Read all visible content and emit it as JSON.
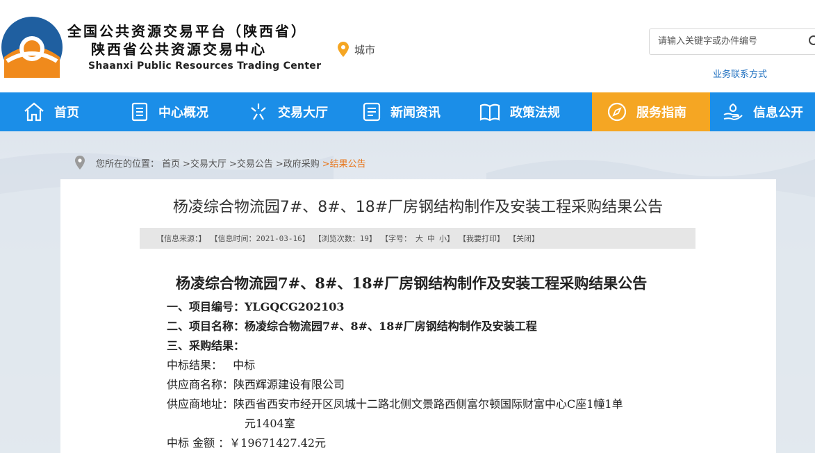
{
  "header": {
    "title_line1": "全国公共资源交易平台（陕西省）",
    "title_line2": "陕西省公共资源交易中心",
    "title_en": "Shaanxi Public Resources Trading Center",
    "city_label": "城市",
    "search_placeholder": "请输入关键字或办件编号",
    "contact_link": "业务联系方式"
  },
  "nav": {
    "items": [
      {
        "label": "首页",
        "icon": "home-icon"
      },
      {
        "label": "中心概况",
        "icon": "document-icon"
      },
      {
        "label": "交易大厅",
        "icon": "sparkle-icon"
      },
      {
        "label": "新闻资讯",
        "icon": "news-icon"
      },
      {
        "label": "政策法规",
        "icon": "book-icon"
      },
      {
        "label": "服务指南",
        "icon": "compass-icon",
        "active": true
      },
      {
        "label": "信息公开",
        "icon": "hand-icon"
      }
    ],
    "active_color": "#f5a623",
    "bar_color": "#1b8ee8"
  },
  "breadcrumb": {
    "prefix": "您所在的位置：",
    "items": [
      "首页",
      ">交易大厅",
      ">交易公告",
      ">政府采购"
    ],
    "current": ">结果公告"
  },
  "article": {
    "page_title": "杨凌综合物流园7#、8#、18#厂房钢结构制作及安装工程采购结果公告",
    "info_bar": {
      "source": "【信息来源：】",
      "time": "【信息时间：2021-03-16】",
      "views": "【浏览次数：19】",
      "font_label": "【字号：",
      "font_large": "大",
      "font_medium": "中",
      "font_small": "小】",
      "print": "【我要打印】",
      "close": "【关闭】"
    },
    "body_title": "杨凌综合物流园7#、8#、18#厂房钢结构制作及安装工程采购结果公告",
    "project_no": "一、项目编号：YLGQCG202103",
    "project_name": "二、项目名称：杨凌综合物流园7#、8#、18#厂房钢结构制作及安装工程",
    "result_heading": "三、采购结果：",
    "bid_result": "中标结果：   中标",
    "supplier_name": "供应商名称：陕西辉源建设有限公司",
    "supplier_addr_1": "供应商地址：陕西省西安市经开区凤城十二路北侧文景路西侧富尔顿国际财富中心C座1幢1单",
    "supplier_addr_2": "元1404室",
    "bid_amount": "中标 金额 ：￥19671427.42元"
  }
}
